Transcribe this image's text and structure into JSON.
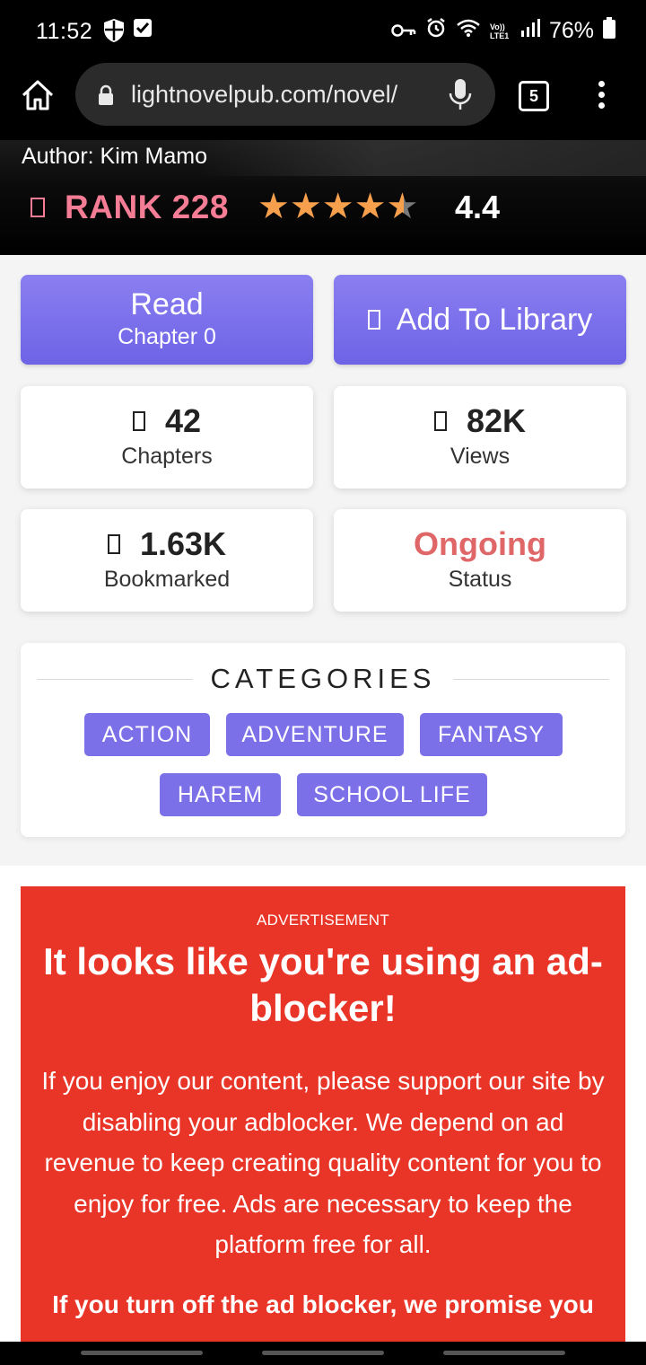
{
  "status_bar": {
    "time": "11:52",
    "battery": "76%",
    "icons": [
      "shield-icon",
      "check-box-icon",
      "key-icon",
      "alarm-icon",
      "wifi-icon",
      "volte-icon",
      "signal-icon",
      "battery-icon"
    ],
    "volte_label": "Vo)) LTE1"
  },
  "browser": {
    "url": "lightnovelpub.com/novel/",
    "tab_count": "5"
  },
  "novel": {
    "author": "Author: Kim Mamo",
    "rank": "RANK 228",
    "rating_value": 4.4,
    "rating_text": "4.4",
    "star_color": "#f6a04d"
  },
  "actions": {
    "read_label": "Read",
    "read_sub": "Chapter 0",
    "library_label": "Add To Library"
  },
  "stats": {
    "chapters_value": "42",
    "chapters_label": "Chapters",
    "views_value": "82K",
    "views_label": "Views",
    "bookmarked_value": "1.63K",
    "bookmarked_label": "Bookmarked",
    "status_value": "Ongoing",
    "status_label": "Status"
  },
  "categories": {
    "heading": "CATEGORIES",
    "tags": [
      "ACTION",
      "ADVENTURE",
      "FANTASY",
      "HAREM",
      "SCHOOL LIFE"
    ]
  },
  "ad": {
    "label": "ADVERTISEMENT",
    "headline": "It looks like you're using an ad-blocker!",
    "paragraph": "If you enjoy our content, please support our site by disabling your adblocker. We depend on ad revenue to keep creating quality content for you to enjoy for free. Ads are necessary to keep the platform free for all.",
    "promise": "If you turn off the ad blocker, we promise you"
  },
  "colors": {
    "accent": "#7c70e8",
    "rank": "#f47c94",
    "status": "#e06767",
    "ad_background": "#e83527"
  }
}
